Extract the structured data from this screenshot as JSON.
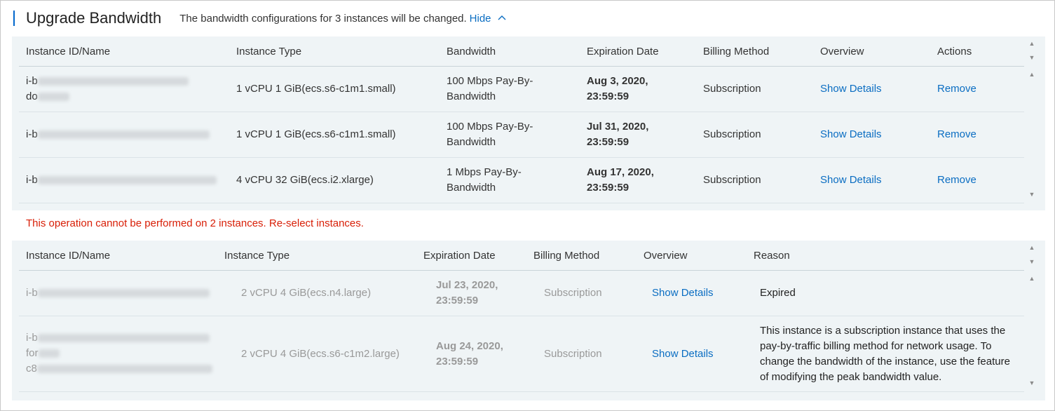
{
  "header": {
    "title": "Upgrade Bandwidth",
    "description": "The bandwidth configurations for 3 instances will be changed.",
    "hide_label": "Hide"
  },
  "changed_table": {
    "columns": [
      "Instance ID/Name",
      "Instance Type",
      "Bandwidth",
      "Expiration Date",
      "Billing Method",
      "Overview",
      "Actions"
    ],
    "rows": [
      {
        "id_prefix": "i-b",
        "id_line2": "do",
        "type": "1 vCPU 1 GiB(ecs.s6-c1m1.small)",
        "bandwidth_l1": "100 Mbps Pay-By-",
        "bandwidth_l2": "Bandwidth",
        "exp_l1": "Aug 3, 2020,",
        "exp_l2": "23:59:59",
        "billing": "Subscription",
        "overview": "Show Details",
        "action": "Remove"
      },
      {
        "id_prefix": "i-b",
        "id_line2": "",
        "type": "1 vCPU 1 GiB(ecs.s6-c1m1.small)",
        "bandwidth_l1": "100 Mbps Pay-By-",
        "bandwidth_l2": "Bandwidth",
        "exp_l1": "Jul 31, 2020,",
        "exp_l2": "23:59:59",
        "billing": "Subscription",
        "overview": "Show Details",
        "action": "Remove"
      },
      {
        "id_prefix": "i-b",
        "id_line2": "",
        "type": "4 vCPU 32 GiB(ecs.i2.xlarge)",
        "bandwidth_l1": "1 Mbps Pay-By-",
        "bandwidth_l2": "Bandwidth",
        "exp_l1": "Aug 17, 2020,",
        "exp_l2": "23:59:59",
        "billing": "Subscription",
        "overview": "Show Details",
        "action": "Remove"
      }
    ]
  },
  "error_message": "This operation cannot be performed on 2 instances. Re-select instances.",
  "failed_table": {
    "columns": [
      "Instance ID/Name",
      "Instance Type",
      "Expiration Date",
      "Billing Method",
      "Overview",
      "Reason"
    ],
    "rows": [
      {
        "id_l1": "i-b",
        "id_l2": "",
        "id_l3": "",
        "type": "2 vCPU 4 GiB(ecs.n4.large)",
        "exp_l1": "Jul 23, 2020,",
        "exp_l2": "23:59:59",
        "billing": "Subscription",
        "overview": "Show Details",
        "reason": "Expired"
      },
      {
        "id_l1": "i-b",
        "id_l2": "for",
        "id_l3": "c8",
        "type": "2 vCPU 4 GiB(ecs.s6-c1m2.large)",
        "exp_l1": "Aug 24, 2020,",
        "exp_l2": "23:59:59",
        "billing": "Subscription",
        "overview": "Show Details",
        "reason": "This instance is a subscription instance that uses the pay-by-traffic billing method for network usage. To change the bandwidth of the instance, use the feature of modifying the peak bandwidth value."
      }
    ]
  },
  "colors": {
    "accent": "#0a6dc2",
    "error": "#d81e06",
    "panel_bg": "#eff4f6"
  },
  "icons": {
    "hide": "chevron-up-icon",
    "scroll_up": "scroll-up-arrow-icon",
    "scroll_down": "scroll-down-arrow-icon"
  }
}
